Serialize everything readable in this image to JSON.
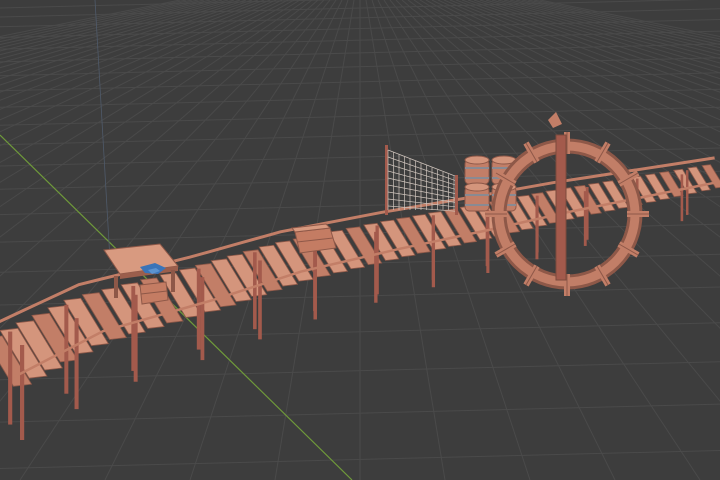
{
  "viewport": {
    "view": "3d-viewport",
    "shading": "solid",
    "colors": {
      "background": "#3d3d3d",
      "grid_line": "#4a4a4a",
      "axis_y": "#6f9a3a",
      "axis_z": "#4f5a6a",
      "wood_light": "#d4957c",
      "wood_mid": "#c27e67",
      "wood_dark": "#8e5848",
      "post": "#a35a4c",
      "net": "#cfc4bc",
      "barrel_band": "#8a8a92",
      "cloth": "#3a74b8"
    }
  },
  "scene": {
    "objects": [
      "plank-walkway",
      "support-posts",
      "rope-rails",
      "table",
      "blue-cloth",
      "crates",
      "rope-net",
      "barrel-stack",
      "ships-wheel-arch"
    ]
  }
}
